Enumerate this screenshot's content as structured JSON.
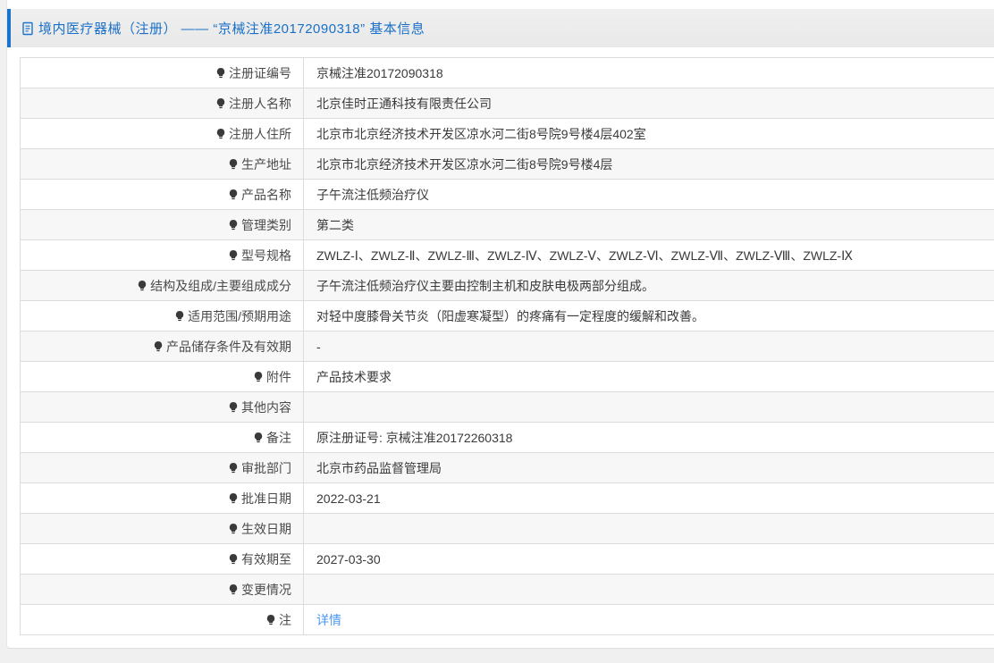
{
  "page": {
    "title": "境内医疗器械（注册） —— “京械注准20172090318” 基本信息"
  },
  "colors": {
    "accent_blue": "#1b73cd",
    "title_blue": "#1a70c8",
    "link_blue": "#4a96f5",
    "stripe_gray": "#f7f7f7",
    "border_gray": "#dcdcdc",
    "titlebar_gray": "#ebebeb"
  },
  "icons": {
    "title_icon": "document-icon",
    "note_icon": "bulb-icon"
  },
  "table": {
    "rows": [
      {
        "label": "注册证编号",
        "value": "京械注准20172090318"
      },
      {
        "label": "注册人名称",
        "value": "北京佳时正通科技有限责任公司"
      },
      {
        "label": "注册人住所",
        "value": "北京市北京经济技术开发区凉水河二街8号院9号楼4层402室"
      },
      {
        "label": "生产地址",
        "value": "北京市北京经济技术开发区凉水河二街8号院9号楼4层"
      },
      {
        "label": "产品名称",
        "value": "子午流注低频治疗仪"
      },
      {
        "label": "管理类别",
        "value": "第二类"
      },
      {
        "label": "型号规格",
        "value": "ZWLZ-Ⅰ、ZWLZ-Ⅱ、ZWLZ-Ⅲ、ZWLZ-Ⅳ、ZWLZ-Ⅴ、ZWLZ-Ⅵ、ZWLZ-Ⅶ、ZWLZ-Ⅷ、ZWLZ-Ⅸ"
      },
      {
        "label": "结构及组成/主要组成成分",
        "value": "子午流注低频治疗仪主要由控制主机和皮肤电极两部分组成。"
      },
      {
        "label": "适用范围/预期用途",
        "value": "对轻中度膝骨关节炎（阳虚寒凝型）的疼痛有一定程度的缓解和改善。"
      },
      {
        "label": "产品储存条件及有效期",
        "value": "-"
      },
      {
        "label": "附件",
        "value": "产品技术要求"
      },
      {
        "label": "其他内容",
        "value": ""
      },
      {
        "label": "备注",
        "value": "原注册证号: 京械注准20172260318"
      },
      {
        "label": "审批部门",
        "value": "北京市药品监督管理局"
      },
      {
        "label": "批准日期",
        "value": "2022-03-21"
      },
      {
        "label": "生效日期",
        "value": ""
      },
      {
        "label": "有效期至",
        "value": "2027-03-30"
      },
      {
        "label": "变更情况",
        "value": ""
      },
      {
        "label": "注",
        "value": "详情",
        "link": true,
        "label_icon": "bulb-icon"
      }
    ]
  }
}
